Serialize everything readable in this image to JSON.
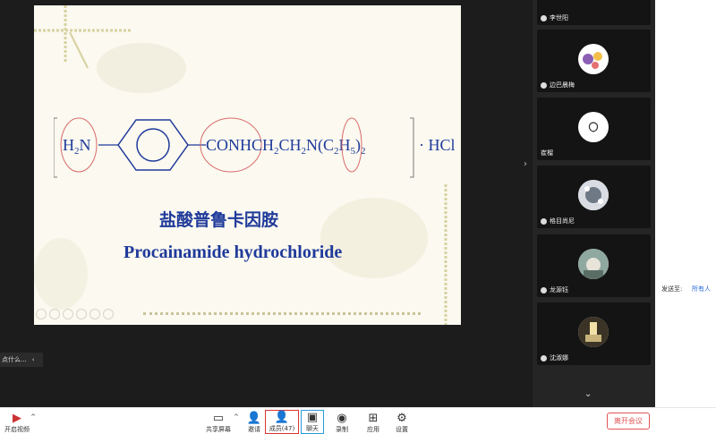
{
  "slide": {
    "cn_title": "盐酸普鲁卡因胺",
    "en_title": "Procainamide hydrochloride",
    "formula": {
      "h2n": "H2N",
      "conh": "CONHCH2CH2N(C2H5)2",
      "hcl": "· HCl"
    }
  },
  "participants": [
    {
      "name": "李世阳"
    },
    {
      "name": "边巴晨梅"
    },
    {
      "name": "崔榴"
    },
    {
      "name": "格目尚尼"
    },
    {
      "name": "龙源钰"
    },
    {
      "name": "沈淑娜"
    }
  ],
  "chat_hint": "点什么...",
  "chat_panel": {
    "send_to_label": "发送至:",
    "send_to_value": "所有人"
  },
  "toolbar": {
    "camera": "开启视频",
    "share": "共享屏幕",
    "invite": "邀请",
    "members": "成员(47)",
    "chat": "聊天",
    "record": "录制",
    "apps": "应用",
    "settings": "设置",
    "leave": "离开会议"
  },
  "colors": {
    "accent_red": "#e05555",
    "accent_blue": "#2a9ad8",
    "slide_text": "#1f3a9a"
  }
}
